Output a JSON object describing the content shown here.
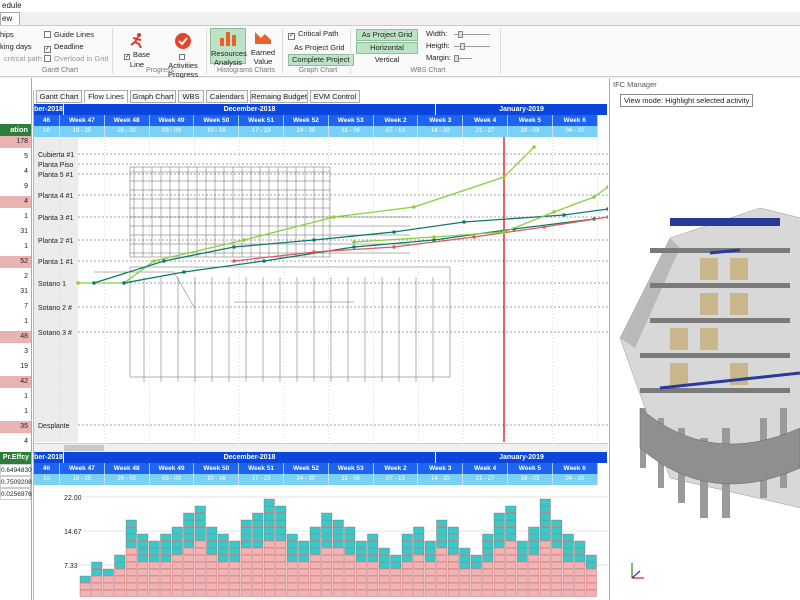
{
  "window": {
    "title": "edule",
    "ribbon_tab": "ew"
  },
  "ribbon": {
    "col1": [
      "hips",
      "king days",
      "critical path"
    ],
    "col2": [
      "Guide Lines",
      "Deadline",
      "Overload in Grid"
    ],
    "gantt_group": "Gantt Chart",
    "progress": {
      "baseline": "Base Line",
      "activities": "Activities Progress",
      "group": "Progress"
    },
    "histograms": {
      "resources": "Resources Analysis",
      "earned": "Earned Value",
      "group": "Histograms Charts"
    },
    "graph": {
      "critical": "Critical Path",
      "as_grid": "As Project Grid",
      "complete": "Complete Project",
      "group": "Graph Chart"
    },
    "wbs": {
      "as_grid": "As Project Grid",
      "horizontal": "Horizontal",
      "vertical": "Vertical",
      "group": "WBS Chart"
    },
    "size": {
      "width": "Width:",
      "height": "Heigth:",
      "margin": "Margin:"
    }
  },
  "left": {
    "header": "ation",
    "rows": [
      "178",
      "5",
      "4",
      "9",
      "4",
      "1",
      "31",
      "1",
      "52",
      "2",
      "31",
      "7",
      "1",
      "48",
      "3",
      "19",
      "42",
      "1",
      "1",
      "35",
      "4"
    ],
    "pink": [
      1,
      0,
      0,
      0,
      1,
      0,
      0,
      0,
      1,
      0,
      0,
      0,
      0,
      1,
      0,
      0,
      1,
      0,
      0,
      1,
      0
    ],
    "lower_header": "Pr.Effcy",
    "lower": [
      "0.6494830",
      "0.7509208",
      "0.0256976"
    ]
  },
  "tabs": [
    "Gantt Chart",
    "Flow Lines",
    "Graph Chart",
    "WBS",
    "Calendars",
    "Remaing Budget",
    "EVM Control"
  ],
  "active_tab": "Flow Lines",
  "timeline": {
    "months": [
      "ber-2018",
      "December-2018",
      "January-2019"
    ],
    "weeks": [
      "46",
      "Week 47",
      "Week 48",
      "Week 49",
      "Week 50",
      "Week 51",
      "Week 52",
      "Week 53",
      "Week 2",
      "Week 3",
      "Week 4",
      "Week 5",
      "Week 6"
    ],
    "days": [
      "10",
      "19 - 25",
      "26 - 02",
      "03 - 09",
      "10 - 16",
      "17 - 23",
      "24 - 30",
      "31 - 06",
      "07 - 13",
      "14 - 20",
      "21 - 27",
      "28 - 03",
      "04 - 10"
    ]
  },
  "levels": [
    "Cubierta #1",
    "Planta Piso",
    "Planta 5 #1",
    "Planta 4 #1",
    "Planta 3 #1",
    "Planta 2 #1",
    "Planta 1 #1",
    "Sotano 1",
    "Sotano 2 #",
    "Sotano 3 #",
    "Desplante"
  ],
  "histogram": {
    "y_ticks": [
      "22.00",
      "14.67",
      "7.33"
    ]
  },
  "ifc": {
    "title": "IFC Manager",
    "view_mode": "View mode: Highlight selected activity"
  },
  "colors": {
    "header_dark": "#0a46dc",
    "header_mid": "#1e64f0",
    "header_light": "#7ad1f5",
    "flow_green": "#8ccf3c",
    "flow_teal": "#0e7a6e",
    "flow_red": "#e05a5a",
    "today": "#e02020",
    "hist_cyan": "#3cc8c8",
    "hist_pink": "#f0b4b4"
  }
}
